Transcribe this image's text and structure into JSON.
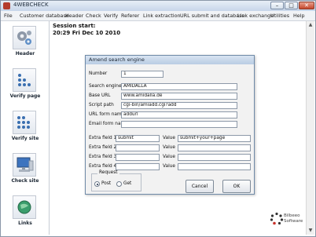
{
  "window": {
    "title": "4WEBCHECK",
    "min_label": "–",
    "max_label": "□",
    "close_label": "✕"
  },
  "menu": [
    "File",
    "Customer database",
    "Header",
    "Check",
    "Verify",
    "Referer",
    "Link extraction",
    "URL submit and database",
    "Link exchange",
    "Utilities",
    "Help"
  ],
  "sidebar": {
    "items": [
      {
        "label": "Header",
        "icon": "gears-icon"
      },
      {
        "label": "Verify page",
        "icon": "dots-page-icon"
      },
      {
        "label": "Verify site",
        "icon": "dots-site-icon"
      },
      {
        "label": "Check site",
        "icon": "computer-icon"
      },
      {
        "label": "Links",
        "icon": "globe-icon"
      }
    ]
  },
  "session": {
    "label": "Session start:",
    "date": "20:29 Fri Dec 10 2010"
  },
  "dialog": {
    "title": "Amend search engine",
    "number_label": "Number",
    "number_value": "1",
    "search_engine_label": "Search engine",
    "search_engine_value": "AMIDALLA",
    "base_url_label": "Base URL",
    "base_url_value": "www.amidalla.de",
    "script_path_label": "Script path",
    "script_path_value": "cgi-bin/amiadd.cgi?add",
    "url_form_name_label": "URL form name",
    "url_form_name_value": "addurl",
    "email_form_name_label": "Email form name",
    "email_form_name_value": "",
    "extra_fields": [
      {
        "label": "Extra field 1",
        "value_label": "Value",
        "field": "submit",
        "value": "submit+your+page"
      },
      {
        "label": "Extra field 2",
        "value_label": "Value",
        "field": "",
        "value": ""
      },
      {
        "label": "Extra field 3",
        "value_label": "Value",
        "field": "",
        "value": ""
      },
      {
        "label": "Extra field 4",
        "value_label": "Value",
        "field": "",
        "value": ""
      }
    ],
    "request": {
      "group_label": "Request",
      "options": [
        "Post",
        "Get"
      ],
      "selected": "Post"
    },
    "cancel_label": "Cancel",
    "ok_label": "OK"
  },
  "footer": {
    "brand_line1": "Bilbeeo",
    "brand_line2": "Software"
  },
  "colors": {
    "accent": "#b43c2c",
    "titlebar": "#c7d6ea",
    "dialog_bg": "#f2f2f2"
  }
}
